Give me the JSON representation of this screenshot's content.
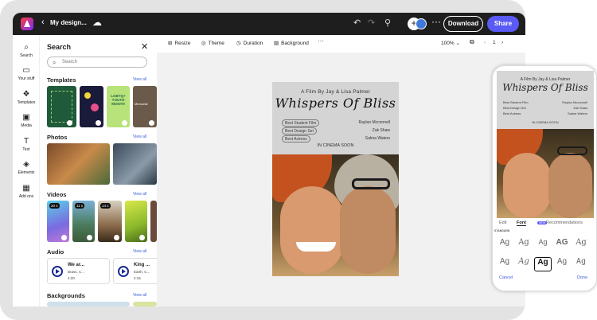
{
  "header": {
    "back_icon": "‹",
    "title": "My design...",
    "cloud_icon": "☁",
    "undo": "↶",
    "redo": "↷",
    "pin": "⚲",
    "plus": "+",
    "more": "···",
    "download": "Download",
    "share": "Share"
  },
  "rail": [
    {
      "icon": "⌕",
      "label": "Search"
    },
    {
      "icon": "▭",
      "label": "Your stuff"
    },
    {
      "icon": "❖",
      "label": "Templates"
    },
    {
      "icon": "▣",
      "label": "Media"
    },
    {
      "icon": "T",
      "label": "Text"
    },
    {
      "icon": "◈",
      "label": "Elements"
    },
    {
      "icon": "▦",
      "label": "Add ons"
    }
  ],
  "panel": {
    "title": "Search",
    "close": "✕",
    "search_placeholder": "Search",
    "view_all": "View all",
    "sections": {
      "templates": "Templates",
      "photos": "Photos",
      "videos": "Videos",
      "audio": "Audio",
      "backgrounds": "Backgrounds"
    },
    "templates": [
      "LGBTQ+ YOUTH MONTH",
      "Memorial"
    ],
    "videos": [
      "20 s",
      "11 s",
      "14 s"
    ],
    "audio": [
      {
        "title": "We ar...",
        "artist": "Brass, C...",
        "duration": "4:20"
      },
      {
        "title": "King ...",
        "artist": "Earth, C...",
        "duration": "2:15"
      }
    ]
  },
  "toolbar": {
    "resize": "Resize",
    "theme": "Theme",
    "duration": "Duration",
    "background": "Background",
    "more": "···",
    "zoom": "100%",
    "page": "1"
  },
  "poster": {
    "credit": "A Film By Jay & Lisa Palmer",
    "title": "Whispers Of Bliss",
    "awards": [
      "Best Student Film",
      "Best Design Set",
      "Best Actress"
    ],
    "cast": [
      "Raylan Mcconnell",
      "Zak Shaw",
      "Salma Waters"
    ],
    "soon": "IN CINEMA SOON"
  },
  "phone": {
    "tabs": [
      "Edit",
      "Font",
      "Recommendations"
    ],
    "new_badge": "NEW",
    "standard": "STANDARD",
    "fonts": [
      "Ag",
      "Ag",
      "Ag",
      "AG",
      "Ag",
      "Ag",
      "Ag",
      "Ag",
      "Ag",
      "Ag"
    ],
    "cancel": "Cancel",
    "done": "Done"
  }
}
